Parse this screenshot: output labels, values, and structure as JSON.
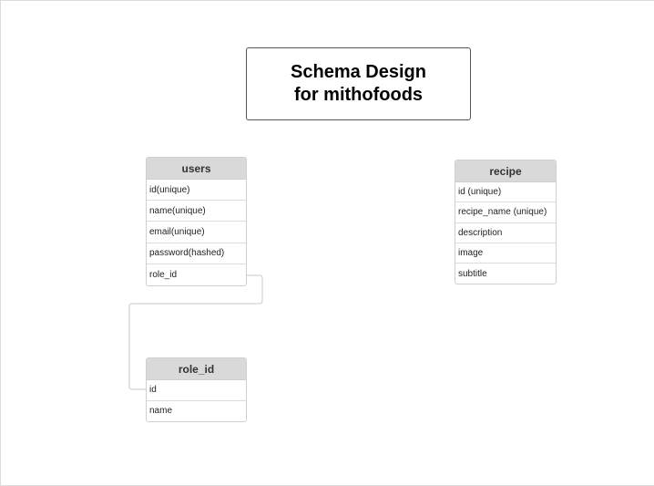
{
  "title": {
    "line1": "Schema Design",
    "line2": "for mithofoods"
  },
  "entities": {
    "users": {
      "name": "users",
      "fields": [
        "id(unique)",
        "name(unique)",
        "email(unique)",
        "password(hashed)",
        "role_id"
      ]
    },
    "recipe": {
      "name": "recipe",
      "fields": [
        "id (unique)",
        "recipe_name (unique)",
        "description",
        "image",
        "subtitle"
      ]
    },
    "role": {
      "name": "role_id",
      "fields": [
        "id",
        "name"
      ]
    }
  },
  "relationships": [
    {
      "from": "users.role_id",
      "to": "role_id.id"
    }
  ],
  "colors": {
    "header_fill": "#d9d9d9",
    "border": "#cfcfcf",
    "title_border": "#555555",
    "connector": "#c8c8c8"
  }
}
